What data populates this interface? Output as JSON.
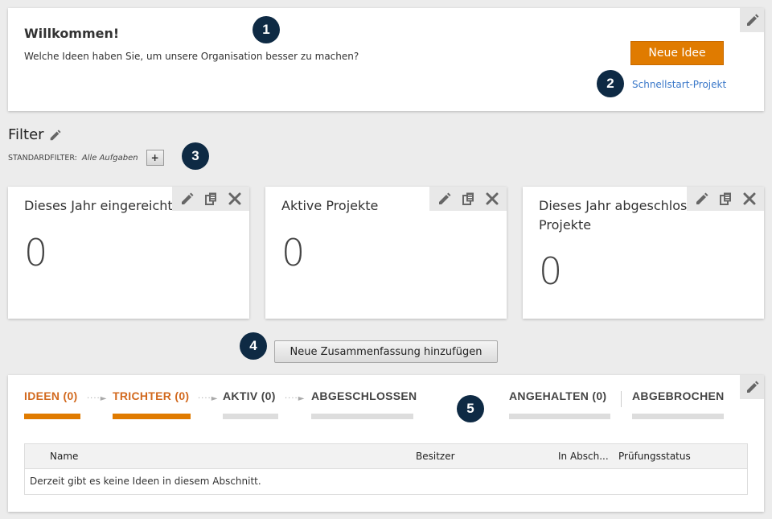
{
  "welcome": {
    "title": "Willkommen!",
    "subtitle": "Welche Ideen haben Sie, um unsere Organisation besser zu machen?",
    "new_idea_button": "Neue Idee",
    "quickstart_link": "Schnellstart-Projekt"
  },
  "filter": {
    "heading": "Filter",
    "standard_label": "STANDARDFILTER:",
    "standard_value": "Alle Aufgaben",
    "add_button": "+"
  },
  "tiles": [
    {
      "title": "Dieses Jahr eingereichte Ideen",
      "value": "0"
    },
    {
      "title": "Aktive Projekte",
      "value": "0"
    },
    {
      "title": "Dieses Jahr abgeschlossene Projekte",
      "value": "0"
    }
  ],
  "add_summary_button": "Neue Zusammenfassung hinzufügen",
  "badges": [
    "1",
    "2",
    "3",
    "4",
    "5"
  ],
  "pipeline": {
    "tabs": [
      {
        "label": "IDEEN (0)",
        "active": true
      },
      {
        "label": "TRICHTER (0)",
        "active": true
      },
      {
        "label": "AKTIV (0)",
        "active": false
      },
      {
        "label": "ABGESCHLOSSEN",
        "active": false
      },
      {
        "label": "ANGEHALTEN (0)",
        "active": false
      },
      {
        "label": "ABGEBROCHEN",
        "active": false
      }
    ],
    "columns": [
      "Name",
      "Besitzer",
      "In Absch...",
      "Prüfungsstatus"
    ],
    "empty_message": "Derzeit gibt es keine Ideen in diesem Abschnitt."
  },
  "colors": {
    "accent": "#e07b00",
    "tab_active_text": "#d2691e",
    "tab_inactive_bar": "#dddddd",
    "badge_bg": "#0e2a44",
    "link": "#3a78c9"
  },
  "icons": {
    "edit": "pencil-icon",
    "copy": "copy-icon",
    "close": "close-icon"
  }
}
